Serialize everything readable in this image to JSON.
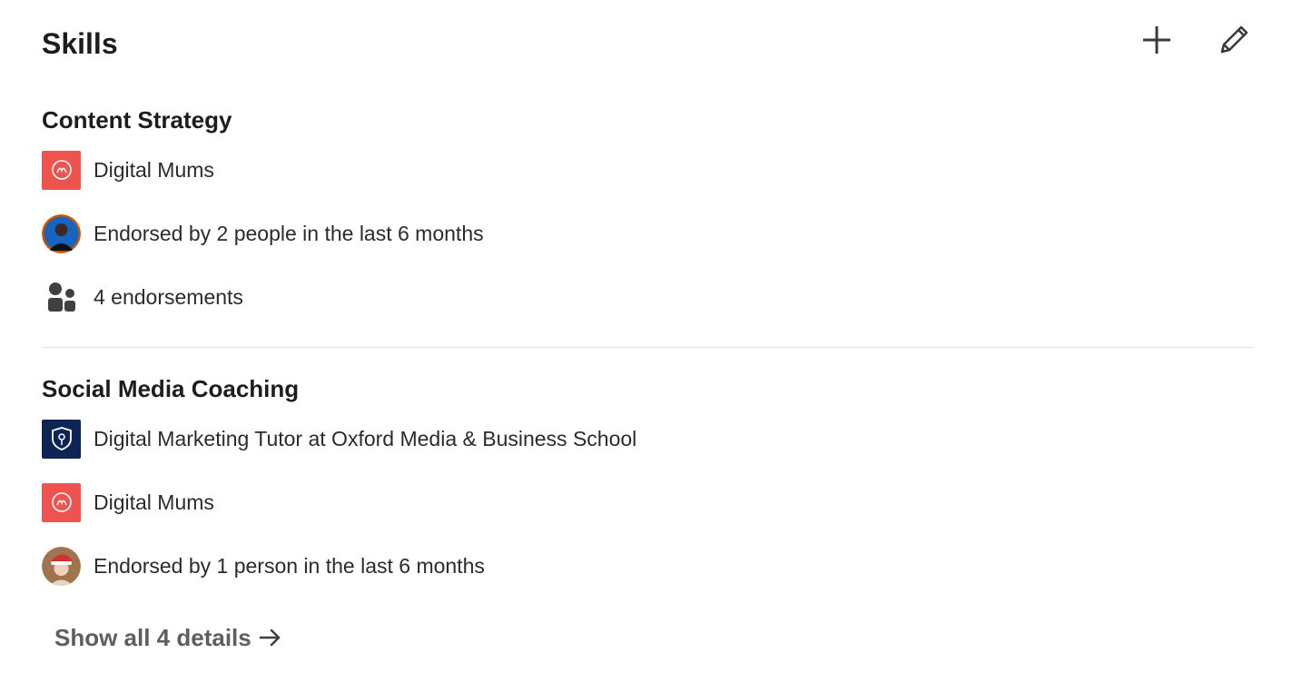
{
  "section": {
    "title": "Skills",
    "add_icon": "plus-icon",
    "edit_icon": "pencil-icon"
  },
  "skills": [
    {
      "name": "Content Strategy",
      "rows": [
        {
          "icon": "digital-mums-logo",
          "text": "Digital Mums"
        },
        {
          "icon": "endorser-avatar",
          "text": "Endorsed by 2 people in the last 6 months"
        },
        {
          "icon": "people-icon",
          "text": "4 endorsements"
        }
      ]
    },
    {
      "name": "Social Media Coaching",
      "rows": [
        {
          "icon": "oxford-media-business-school-logo",
          "text": "Digital Marketing Tutor at Oxford Media & Business School"
        },
        {
          "icon": "digital-mums-logo",
          "text": "Digital Mums"
        },
        {
          "icon": "endorser-avatar",
          "text": "Endorsed by 1 person in the last 6 months"
        }
      ]
    }
  ],
  "footer": {
    "show_all_label": "Show all 4 details",
    "arrow_icon": "arrow-right-icon"
  },
  "colors": {
    "digital_mums_brand": "#ef5350",
    "oxford_brand": "#0e2454",
    "text_primary": "#1d1d1d",
    "text_secondary": "#5e5e5e"
  }
}
